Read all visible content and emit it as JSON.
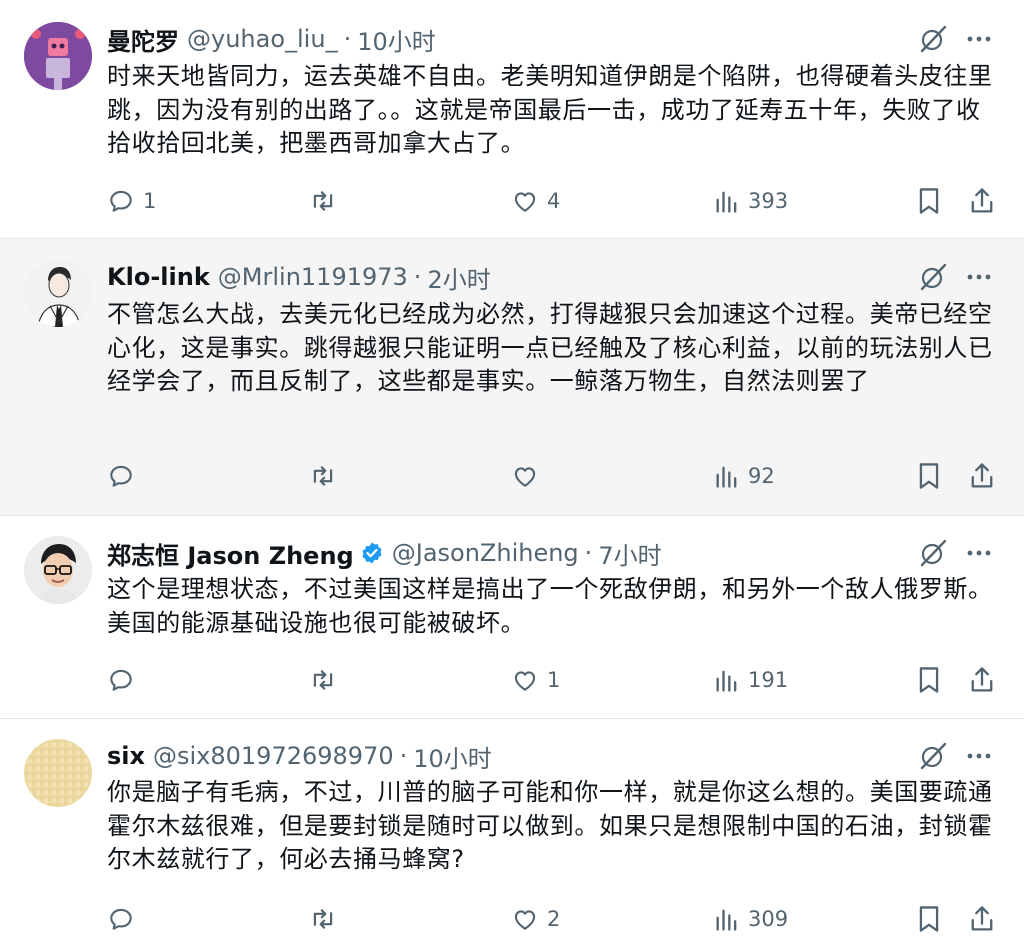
{
  "tweets": [
    {
      "name": "曼陀罗",
      "handle": "@yuhao_liu_",
      "dot": "·",
      "time": "10小时",
      "verified": false,
      "highlighted": false,
      "text": "时来天地皆同力，运去英雄不自由。老美明知道伊朗是个陷阱，也得硬着头皮往里跳，因为没有别的出路了。。这就是帝国最后一击，成功了延寿五十年，失败了收拾收拾回北美，把墨西哥加拿大占了。",
      "replies": "1",
      "retweets": "",
      "likes": "4",
      "views": "393"
    },
    {
      "name": "Klo-link",
      "handle": "@Mrlin1191973",
      "dot": "·",
      "time": "2小时",
      "verified": false,
      "highlighted": true,
      "text": "不管怎么大战，去美元化已经成为必然，打得越狠只会加速这个过程。美帝已经空心化，这是事实。跳得越狠只能证明一点已经触及了核心利益，以前的玩法别人已经学会了，而且反制了，这些都是事实。一鲸落万物生，自然法则罢了",
      "replies": "",
      "retweets": "",
      "likes": "",
      "views": "92"
    },
    {
      "name": "郑志恒 Jason Zheng",
      "handle": "@JasonZhiheng",
      "dot": "·",
      "time": "7小时",
      "verified": true,
      "highlighted": false,
      "text": "这个是理想状态，不过美国这样是搞出了一个死敌伊朗，和另外一个敌人俄罗斯。美国的能源基础设施也很可能被破坏。",
      "replies": "",
      "retweets": "",
      "likes": "1",
      "views": "191"
    },
    {
      "name": "six",
      "handle": "@six801972698970",
      "dot": "·",
      "time": "10小时",
      "verified": false,
      "highlighted": false,
      "text": "你是脑子有毛病，不过，川普的脑子可能和你一样，就是你这么想的。美国要疏通霍尔木兹很难，但是要封锁是随时可以做到。如果只是想限制中国的石油，封锁霍尔木兹就行了，何必去捅马蜂窝?",
      "replies": "",
      "retweets": "",
      "likes": "2",
      "views": "309"
    }
  ],
  "icons": {
    "reply": "reply-icon",
    "retweet": "retweet-icon",
    "like": "heart-icon",
    "views": "views-icon",
    "bookmark": "bookmark-icon",
    "share": "share-icon",
    "grok": "grok-icon",
    "more": "more-icon",
    "verified": "verified-badge-icon"
  },
  "colors": {
    "text": "#0f1419",
    "secondary": "#536471",
    "verified": "#1d9bf0",
    "highlight_bg": "#f5f5f5",
    "divider": "#e6e6e6"
  }
}
